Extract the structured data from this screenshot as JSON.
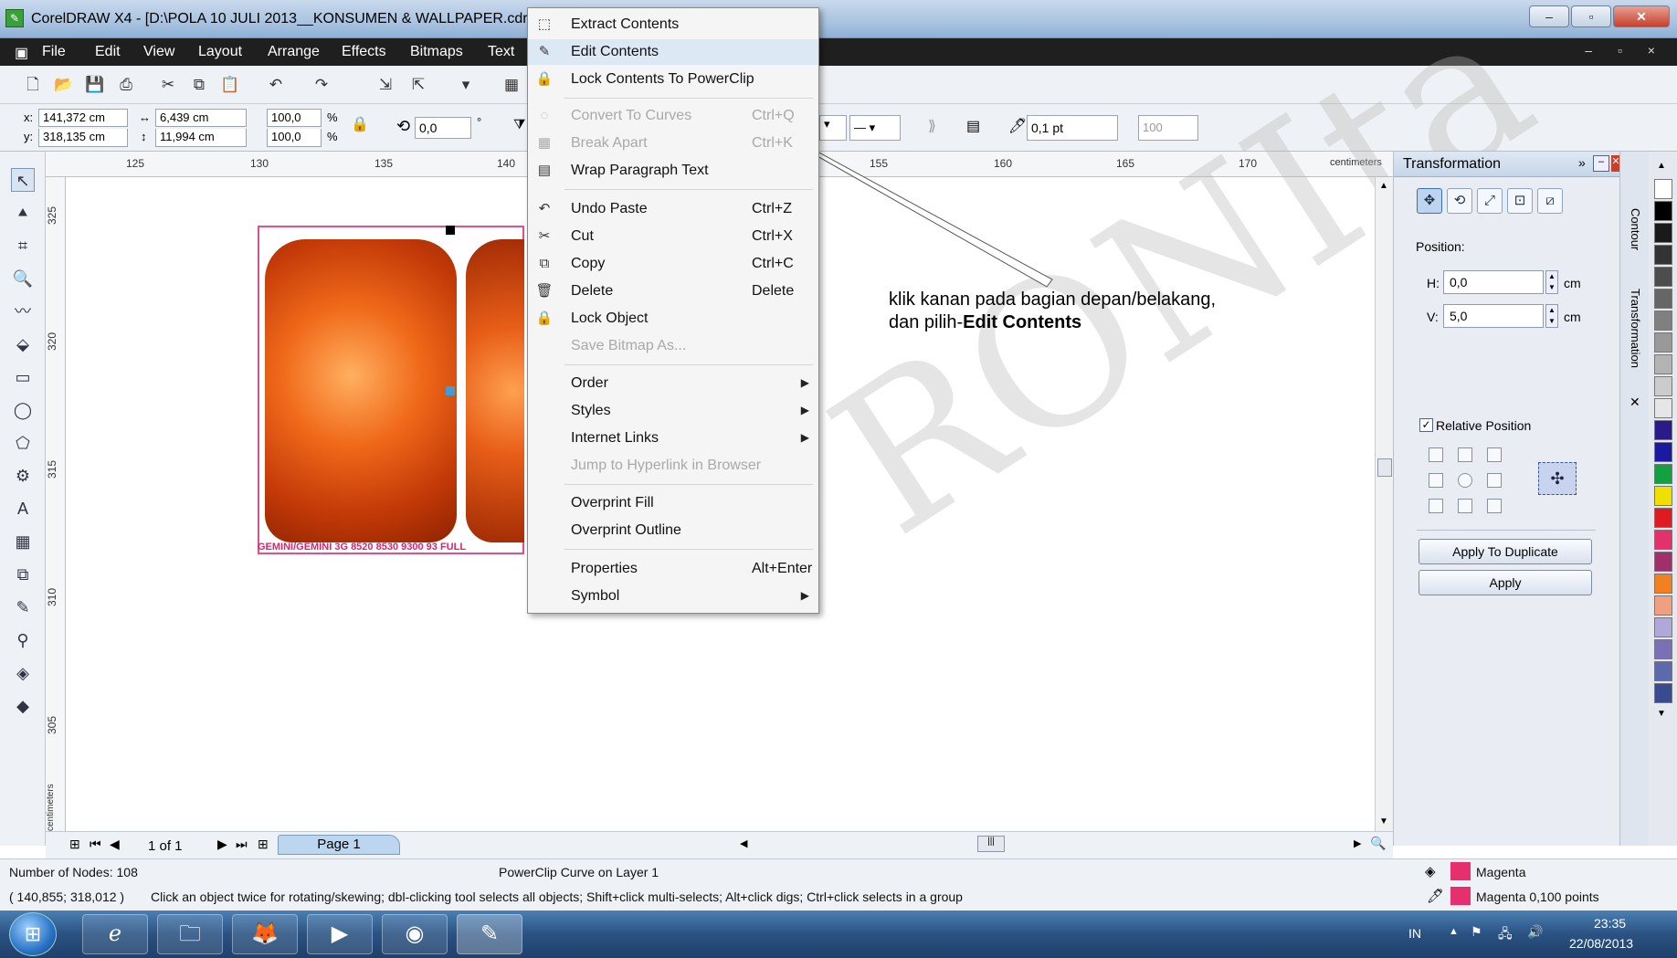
{
  "window": {
    "title": "CorelDRAW X4 - [D:\\POLA 10 JULI 2013__KONSUMEN & WALLPAPER.cdr]",
    "buttons": [
      "–",
      "▫",
      "✕"
    ]
  },
  "menubar": {
    "items": [
      "File",
      "Edit",
      "View",
      "Layout",
      "Arrange",
      "Effects",
      "Bitmaps",
      "Text"
    ],
    "right": "– ▫ ×"
  },
  "propbar": {
    "x_label": "x:",
    "x": "141,372 cm",
    "y_label": "y:",
    "y": "318,135 cm",
    "w": "6,439 cm",
    "h": "11,994 cm",
    "scale_x": "100,0",
    "scale_y": "100,0",
    "pct": "%",
    "angle": "0,0",
    "deg": "°",
    "outline": "0,1 pt",
    "percent": "100"
  },
  "ruler": {
    "unit": "centimeters",
    "h_ticks": [
      "125",
      "130",
      "135",
      "140",
      "155",
      "160",
      "165",
      "170"
    ],
    "v_ticks": [
      "325",
      "320",
      "315",
      "310",
      "305"
    ]
  },
  "design": {
    "label": "GEMINI/GEMINI 3G 8520 8530 9300 93 FULL"
  },
  "context_menu": {
    "items": [
      {
        "label": "Extract Contents",
        "shortcut": "",
        "icon": "extract-icon",
        "glyph": "⬚"
      },
      {
        "label": "Edit Contents",
        "shortcut": "",
        "icon": "edit-contents-icon",
        "glyph": "✎"
      },
      {
        "label": "Lock Contents To PowerClip",
        "shortcut": "",
        "icon": "lock-powerclip-icon",
        "glyph": "🔒"
      },
      {
        "label": "Convert To Curves",
        "shortcut": "Ctrl+Q",
        "icon": "curves-icon",
        "glyph": "◌"
      },
      {
        "label": "Break Apart",
        "shortcut": "Ctrl+K",
        "icon": "break-apart-icon",
        "glyph": "▦"
      },
      {
        "label": "Wrap Paragraph Text",
        "shortcut": "",
        "icon": "wrap-text-icon",
        "glyph": "▤"
      },
      {
        "label": "Undo Paste",
        "shortcut": "Ctrl+Z",
        "icon": "undo-icon",
        "glyph": "↶"
      },
      {
        "label": "Cut",
        "shortcut": "Ctrl+X",
        "icon": "scissors-icon",
        "glyph": "✂"
      },
      {
        "label": "Copy",
        "shortcut": "Ctrl+C",
        "icon": "copy-icon",
        "glyph": "⧉"
      },
      {
        "label": "Delete",
        "shortcut": "Delete",
        "icon": "trash-icon",
        "glyph": "🗑"
      },
      {
        "label": "Lock Object",
        "shortcut": "",
        "icon": "lock-icon",
        "glyph": "🔒"
      },
      {
        "label": "Save Bitmap As...",
        "shortcut": "",
        "icon": "",
        "glyph": ""
      },
      {
        "label": "Order",
        "shortcut": "",
        "icon": "",
        "glyph": ""
      },
      {
        "label": "Styles",
        "shortcut": "",
        "icon": "",
        "glyph": ""
      },
      {
        "label": "Internet Links",
        "shortcut": "",
        "icon": "",
        "glyph": ""
      },
      {
        "label": "Jump to Hyperlink in Browser",
        "shortcut": "",
        "icon": "",
        "glyph": ""
      },
      {
        "label": "Overprint Fill",
        "shortcut": "",
        "icon": "",
        "glyph": ""
      },
      {
        "label": "Overprint Outline",
        "shortcut": "",
        "icon": "",
        "glyph": ""
      },
      {
        "label": "Properties",
        "shortcut": "Alt+Enter",
        "icon": "",
        "glyph": ""
      },
      {
        "label": "Symbol",
        "shortcut": "",
        "icon": "",
        "glyph": ""
      }
    ]
  },
  "callout": {
    "line1": "klik kanan pada bagian depan/belakang,",
    "line2_prefix": "dan pilih-",
    "line2_bold": "Edit Contents"
  },
  "watermark": "RONIta",
  "docker": {
    "title": "Transformation",
    "position_label": "Position:",
    "h_label": "H:",
    "h_value": "0,0",
    "unit": "cm",
    "v_label": "V:",
    "v_value": "5,0",
    "relative": "Relative Position",
    "apply_dup": "Apply To Duplicate",
    "apply": "Apply",
    "tabs": [
      "Contour",
      "Transformation"
    ]
  },
  "page_nav": {
    "pages": "1 of 1",
    "tab": "Page 1"
  },
  "status": {
    "nodes": "Number of Nodes: 108",
    "object": "PowerClip Curve on Layer 1",
    "coords": "( 140,855; 318,012 )",
    "hint": "Click an object twice for rotating/skewing; dbl-clicking tool selects all objects; Shift+click multi-selects; Alt+click digs; Ctrl+click selects in a group",
    "fill": "Magenta",
    "outline": "Magenta  0,100 points"
  },
  "taskbar": {
    "lang": "IN",
    "time": "23:35",
    "date": "22/08/2013"
  },
  "colors": {
    "accent_pink": "#e6306e",
    "menu_dark": "#1f1f1f",
    "canvas": "#ffffff"
  }
}
